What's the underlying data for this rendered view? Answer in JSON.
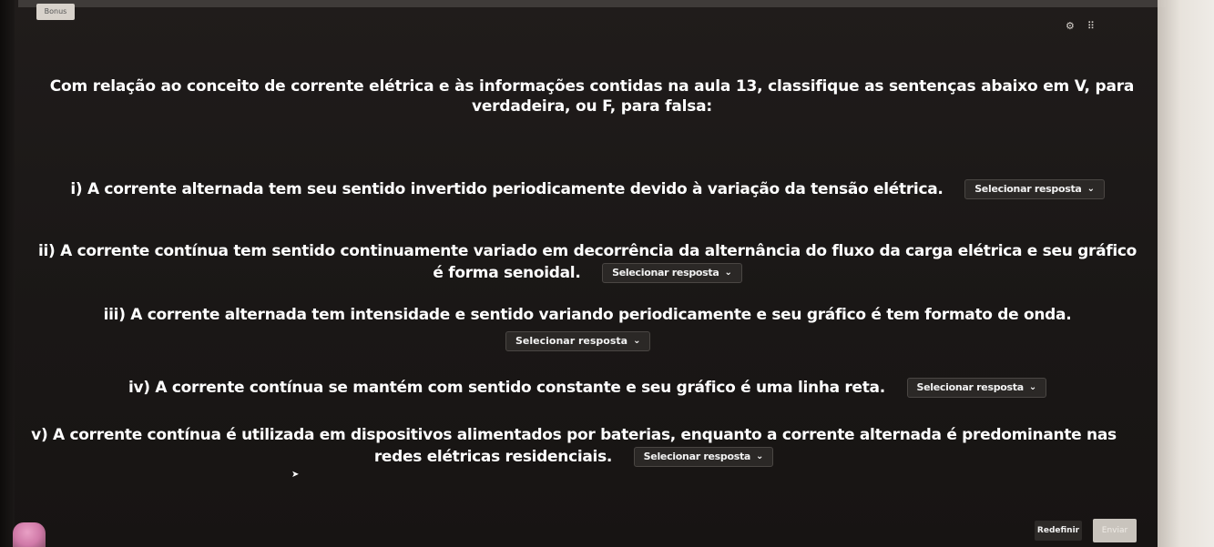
{
  "header": {
    "tag_label": "Bonus"
  },
  "question": {
    "text": "Com relação ao conceito de corrente elétrica e às informações contidas na aula 13, classifique as sentenças abaixo em V, para verdadeira, ou F, para falsa:"
  },
  "statements": [
    {
      "text": "i) A corrente alternada tem seu sentido invertido periodicamente devido à variação da tensão elétrica.",
      "select_label": "Selecionar resposta"
    },
    {
      "text": "ii) A corrente contínua tem sentido continuamente variado em decorrência da alternância do fluxo da carga elétrica e seu gráfico é forma senoidal.",
      "select_label": "Selecionar resposta"
    },
    {
      "text": "iii) A corrente alternada tem intensidade e sentido variando periodicamente e seu gráfico é tem formato de onda.",
      "select_label": "Selecionar resposta"
    },
    {
      "text": "iv) A corrente contínua se mantém com sentido constante e seu gráfico é uma linha reta.",
      "select_label": "Selecionar resposta"
    },
    {
      "text": "v) A corrente contínua é utilizada em dispositivos alimentados por baterias, enquanto a corrente alternada é predominante nas redes elétricas residenciais.",
      "select_label": "Selecionar resposta"
    }
  ],
  "footer": {
    "reset_label": "Redefinir",
    "send_label": "Enviar"
  },
  "icons": {
    "settings": "gear-icon",
    "expand": "grid-icon"
  }
}
